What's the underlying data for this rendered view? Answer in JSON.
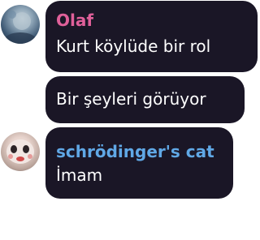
{
  "messages": [
    {
      "author": "Olaf",
      "author_color": "#e0609a",
      "text": "Kurt köylüde bir rol"
    },
    {
      "author": "",
      "text": "Bir şeyleri görüyor"
    },
    {
      "author": "schrödinger's cat",
      "author_color": "#60a8e6",
      "text": "İmam"
    }
  ],
  "colors": {
    "bubble_bg": "#1a1626",
    "page_bg": "#ffffff"
  }
}
